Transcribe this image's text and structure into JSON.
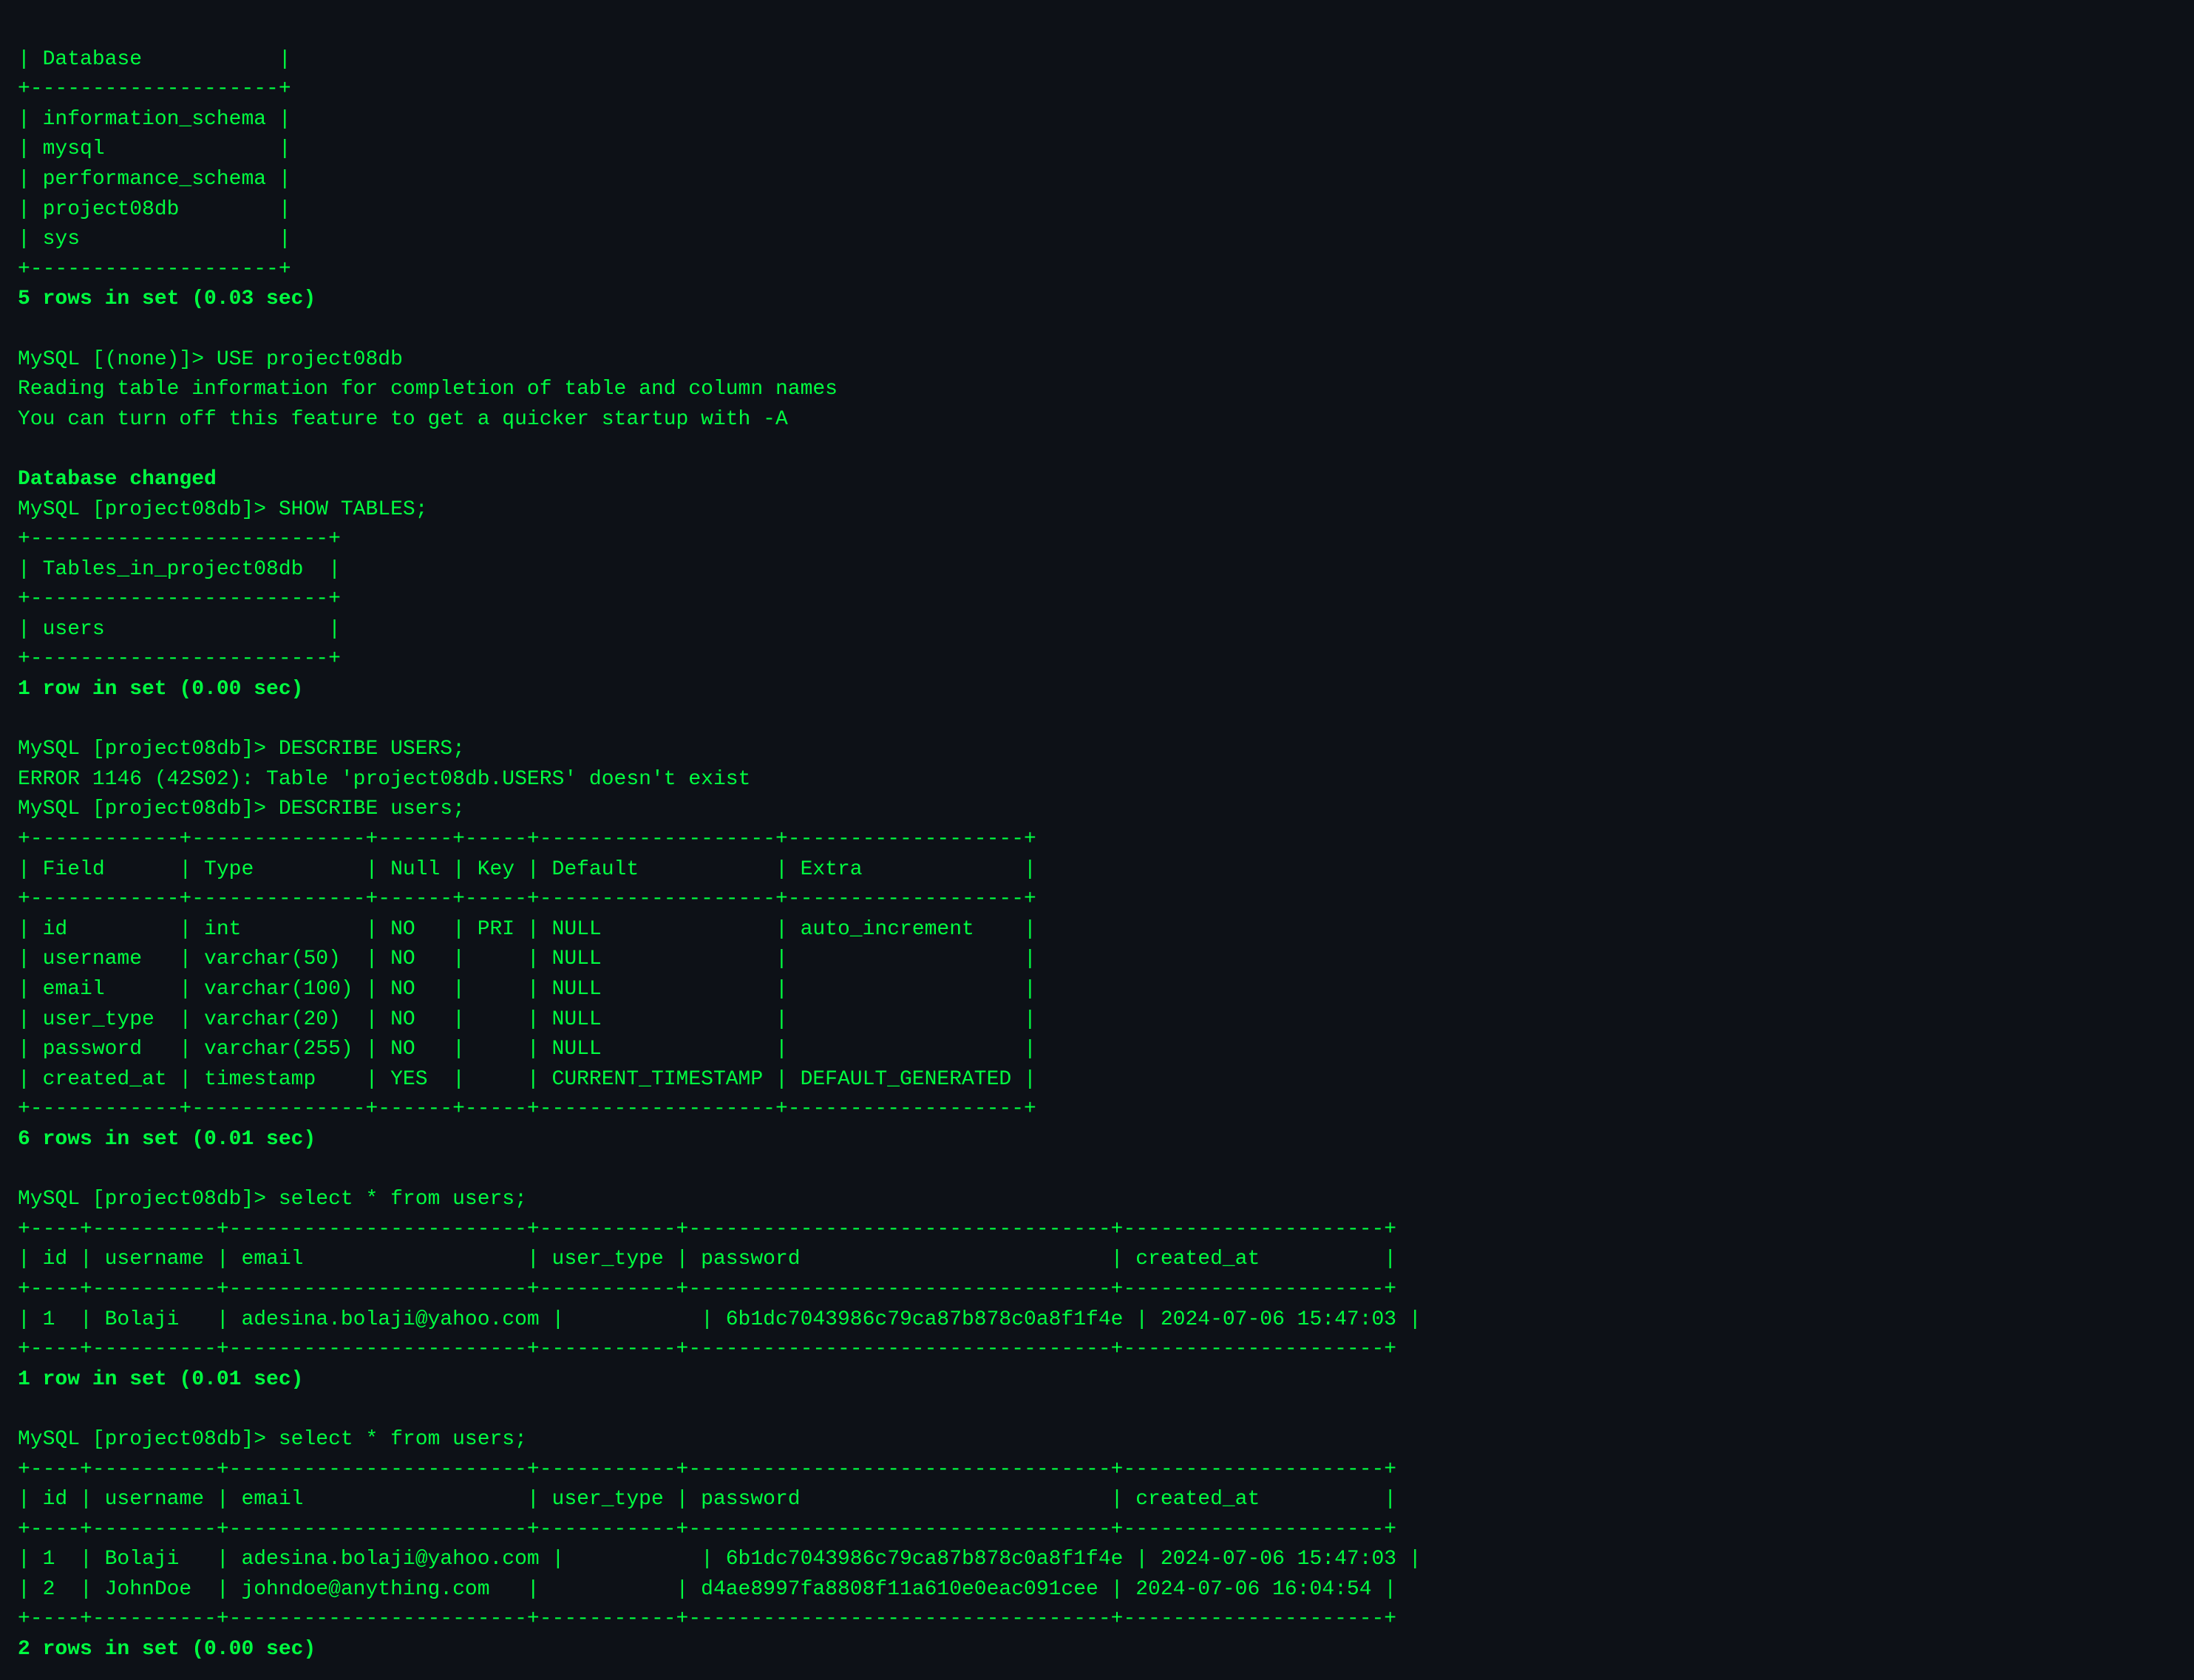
{
  "terminal": {
    "lines": [
      "| Database           |",
      "+--------------------+",
      "| information_schema |",
      "| mysql              |",
      "| performance_schema |",
      "| project08db        |",
      "| sys                |",
      "+--------------------+",
      "5 rows in set (0.03 sec)",
      "",
      "MySQL [(none)]> USE project08db",
      "Reading table information for completion of table and column names",
      "You can turn off this feature to get a quicker startup with -A",
      "",
      "Database changed",
      "MySQL [project08db]> SHOW TABLES;",
      "+------------------------+",
      "| Tables_in_project08db  |",
      "+------------------------+",
      "| users                  |",
      "+------------------------+",
      "1 row in set (0.00 sec)",
      "",
      "MySQL [project08db]> DESCRIBE USERS;",
      "ERROR 1146 (42S02): Table 'project08db.USERS' doesn't exist",
      "MySQL [project08db]> DESCRIBE users;",
      "+------------+--------------+------+-----+-------------------+-------------------+",
      "| Field      | Type         | Null | Key | Default           | Extra             |",
      "+------------+--------------+------+-----+-------------------+-------------------+",
      "| id         | int          | NO   | PRI | NULL              | auto_increment    |",
      "| username   | varchar(50)  | NO   |     | NULL              |                   |",
      "| email      | varchar(100) | NO   |     | NULL              |                   |",
      "| user_type  | varchar(20)  | NO   |     | NULL              |                   |",
      "| password   | varchar(255) | NO   |     | NULL              |                   |",
      "| created_at | timestamp    | YES  |     | CURRENT_TIMESTAMP | DEFAULT_GENERATED |",
      "+------------+--------------+------+-----+-------------------+-------------------+",
      "6 rows in set (0.01 sec)",
      "",
      "MySQL [project08db]> select * from users;",
      "+----+----------+------------------------+-----------+----------------------------------+---------------------+",
      "| id | username | email                  | user_type | password                         | created_at          |",
      "+----+----------+------------------------+-----------+----------------------------------+---------------------+",
      "| 1  | Bolaji   | adesina.bolaji@yahoo.com |           | 6b1dc7043986c79ca87b878c0a8f1f4e | 2024-07-06 15:47:03 |",
      "+----+----------+------------------------+-----------+----------------------------------+---------------------+",
      "1 row in set (0.01 sec)",
      "",
      "MySQL [project08db]> select * from users;",
      "+----+----------+------------------------+-----------+----------------------------------+---------------------+",
      "| id | username | email                  | user_type | password                         | created_at          |",
      "+----+----------+------------------------+-----------+----------------------------------+---------------------+",
      "| 1  | Bolaji   | adesina.bolaji@yahoo.com |           | 6b1dc7043986c79ca87b878c0a8f1f4e | 2024-07-06 15:47:03 |",
      "| 2  | JohnDoe  | johndoe@anything.com   |           | d4ae8997fa8808f11a610e0eac091cee | 2024-07-06 16:04:54 |",
      "+----+----------+------------------------+-----------+----------------------------------+---------------------+",
      "2 rows in set (0.00 sec)"
    ],
    "bold_lines": [
      8,
      14,
      23
    ],
    "accent_color": "#00ff41",
    "bg_color": "#0d1117"
  }
}
